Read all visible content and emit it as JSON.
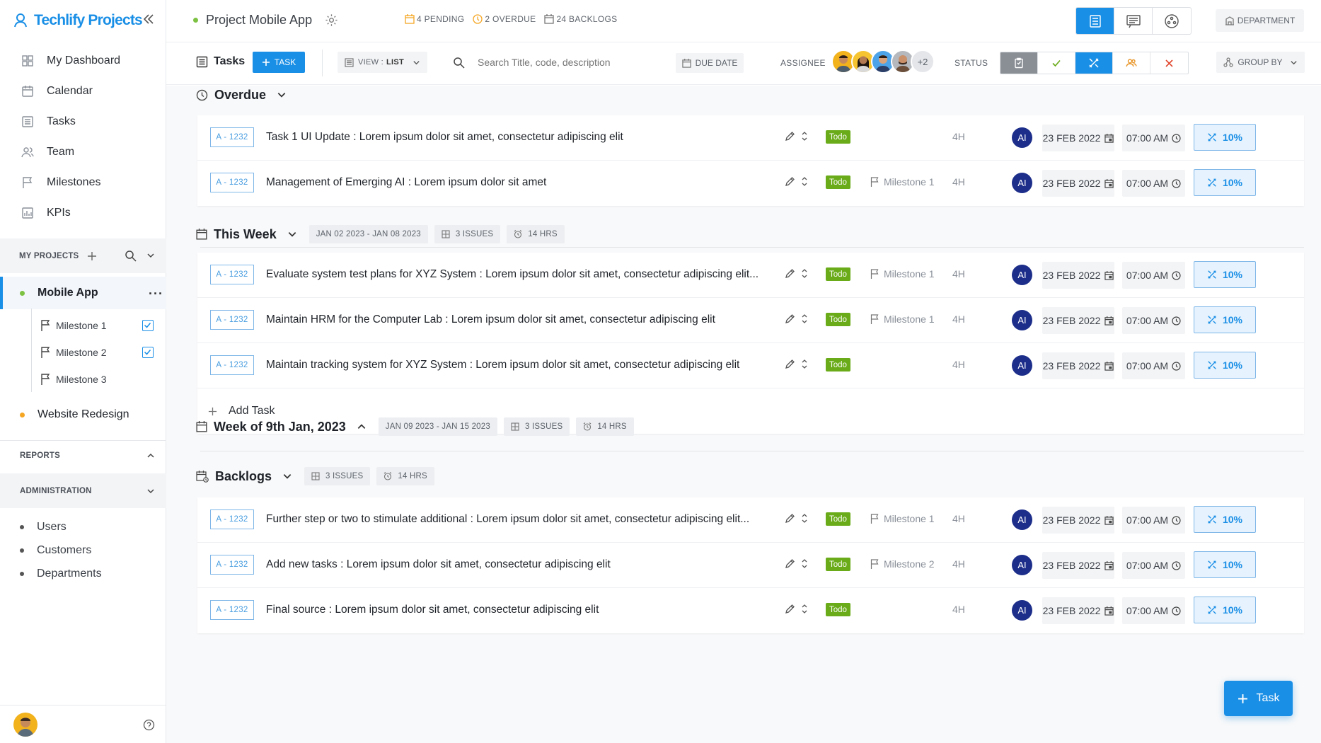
{
  "brand": {
    "name": "Techlify Projects",
    "accent": "#1a8fe6"
  },
  "nav": [
    {
      "label": "My Dashboard",
      "icon": "dashboard-icon"
    },
    {
      "label": "Calendar",
      "icon": "calendar-icon"
    },
    {
      "label": "Tasks",
      "icon": "tasks-icon"
    },
    {
      "label": "Team",
      "icon": "team-icon"
    },
    {
      "label": "Milestones",
      "icon": "milestone-flag-icon"
    },
    {
      "label": "KPIs",
      "icon": "kpi-chart-icon"
    }
  ],
  "my_projects": {
    "label": "MY PROJECTS",
    "projects": [
      {
        "name": "Mobile App",
        "color": "#7cc142",
        "active": true,
        "milestones": [
          {
            "label": "Milestone 1",
            "checked": true
          },
          {
            "label": "Milestone 2",
            "checked": true
          },
          {
            "label": "Milestone 3",
            "checked": false
          }
        ]
      },
      {
        "name": "Website Redesign",
        "color": "#f5a623",
        "active": false
      }
    ]
  },
  "reports": {
    "label": "REPORTS"
  },
  "administration": {
    "label": "ADMINISTRATION",
    "items": [
      "Users",
      "Customers",
      "Departments"
    ]
  },
  "header": {
    "project_title": "Project Mobile App",
    "pending": "4 PENDING",
    "overdue": "2 OVERDUE",
    "backlogs": "24 BACKLOGS",
    "department": "DEPARTMENT"
  },
  "toolbar": {
    "tasks_label": "Tasks",
    "add_task": "TASK",
    "view_prefix": "VIEW :",
    "view_value": "LIST",
    "search_placeholder": "Search Title, code, description",
    "due_date": "DUE DATE",
    "assignee_label": "ASSIGNEE",
    "assignee_more": "+2",
    "status_label": "STATUS",
    "group_by": "GROUP BY"
  },
  "groups": {
    "overdue": {
      "title": "Overdue"
    },
    "this_week": {
      "title": "This Week",
      "range": "JAN 02 2023 - JAN 08 2023",
      "issues": "3 ISSUES",
      "hours": "14 HRS"
    },
    "week9": {
      "title": "Week of 9th Jan, 2023",
      "range": "JAN 09 2023 - JAN 15 2023",
      "issues": "3 ISSUES",
      "hours": "14 HRS"
    },
    "backlogs": {
      "title": "Backlogs",
      "issues": "3 ISSUES",
      "hours": "14 HRS"
    }
  },
  "tasks": {
    "overdue": [
      {
        "code": "A - 1232",
        "title": "Task 1 UI Update : Lorem ipsum dolor sit amet, consectetur adipiscing elit",
        "status": "Todo",
        "milestone": "",
        "hours": "4H",
        "assignee": "AI",
        "date": "23 FEB 2022",
        "time": "07:00 AM",
        "progress": "10%"
      },
      {
        "code": "A - 1232",
        "title": "Management of Emerging AI  : Lorem ipsum dolor sit amet",
        "status": "Todo",
        "milestone": "Milestone 1",
        "hours": "4H",
        "assignee": "AI",
        "date": "23 FEB 2022",
        "time": "07:00 AM",
        "progress": "10%"
      }
    ],
    "this_week": [
      {
        "code": "A - 1232",
        "title": "Evaluate system test plans for XYZ System : Lorem ipsum dolor sit amet, consectetur adipiscing elit...",
        "status": "Todo",
        "milestone": "Milestone 1",
        "hours": "4H",
        "assignee": "AI",
        "date": "23 FEB 2022",
        "time": "07:00 AM",
        "progress": "10%"
      },
      {
        "code": "A - 1232",
        "title": "Maintain HRM for the Computer Lab : Lorem ipsum dolor sit amet, consectetur adipiscing elit",
        "status": "Todo",
        "milestone": "Milestone 1",
        "hours": "4H",
        "assignee": "AI",
        "date": "23 FEB 2022",
        "time": "07:00 AM",
        "progress": "10%"
      },
      {
        "code": "A - 1232",
        "title": "Maintain tracking system for XYZ System : Lorem ipsum dolor sit amet, consectetur adipiscing elit",
        "status": "Todo",
        "milestone": "",
        "hours": "4H",
        "assignee": "AI",
        "date": "23 FEB 2022",
        "time": "07:00 AM",
        "progress": "10%"
      }
    ],
    "backlogs": [
      {
        "code": "A - 1232",
        "title": "Further step or two to stimulate additional : Lorem ipsum dolor sit amet, consectetur adipiscing elit...",
        "status": "Todo",
        "milestone": "Milestone 1",
        "hours": "4H",
        "assignee": "AI",
        "date": "23 FEB 2022",
        "time": "07:00 AM",
        "progress": "10%"
      },
      {
        "code": "A - 1232",
        "title": "Add new tasks : Lorem ipsum dolor sit amet, consectetur adipiscing elit",
        "status": "Todo",
        "milestone": "Milestone 2",
        "hours": "4H",
        "assignee": "AI",
        "date": "23 FEB 2022",
        "time": "07:00 AM",
        "progress": "10%"
      },
      {
        "code": "A - 1232",
        "title": "Final source : Lorem ipsum dolor sit amet, consectetur adipiscing elit",
        "status": "Todo",
        "milestone": "",
        "hours": "4H",
        "assignee": "AI",
        "date": "23 FEB 2022",
        "time": "07:00 AM",
        "progress": "10%"
      }
    ]
  },
  "add_task_row": "Add Task",
  "fab_label": "Task"
}
